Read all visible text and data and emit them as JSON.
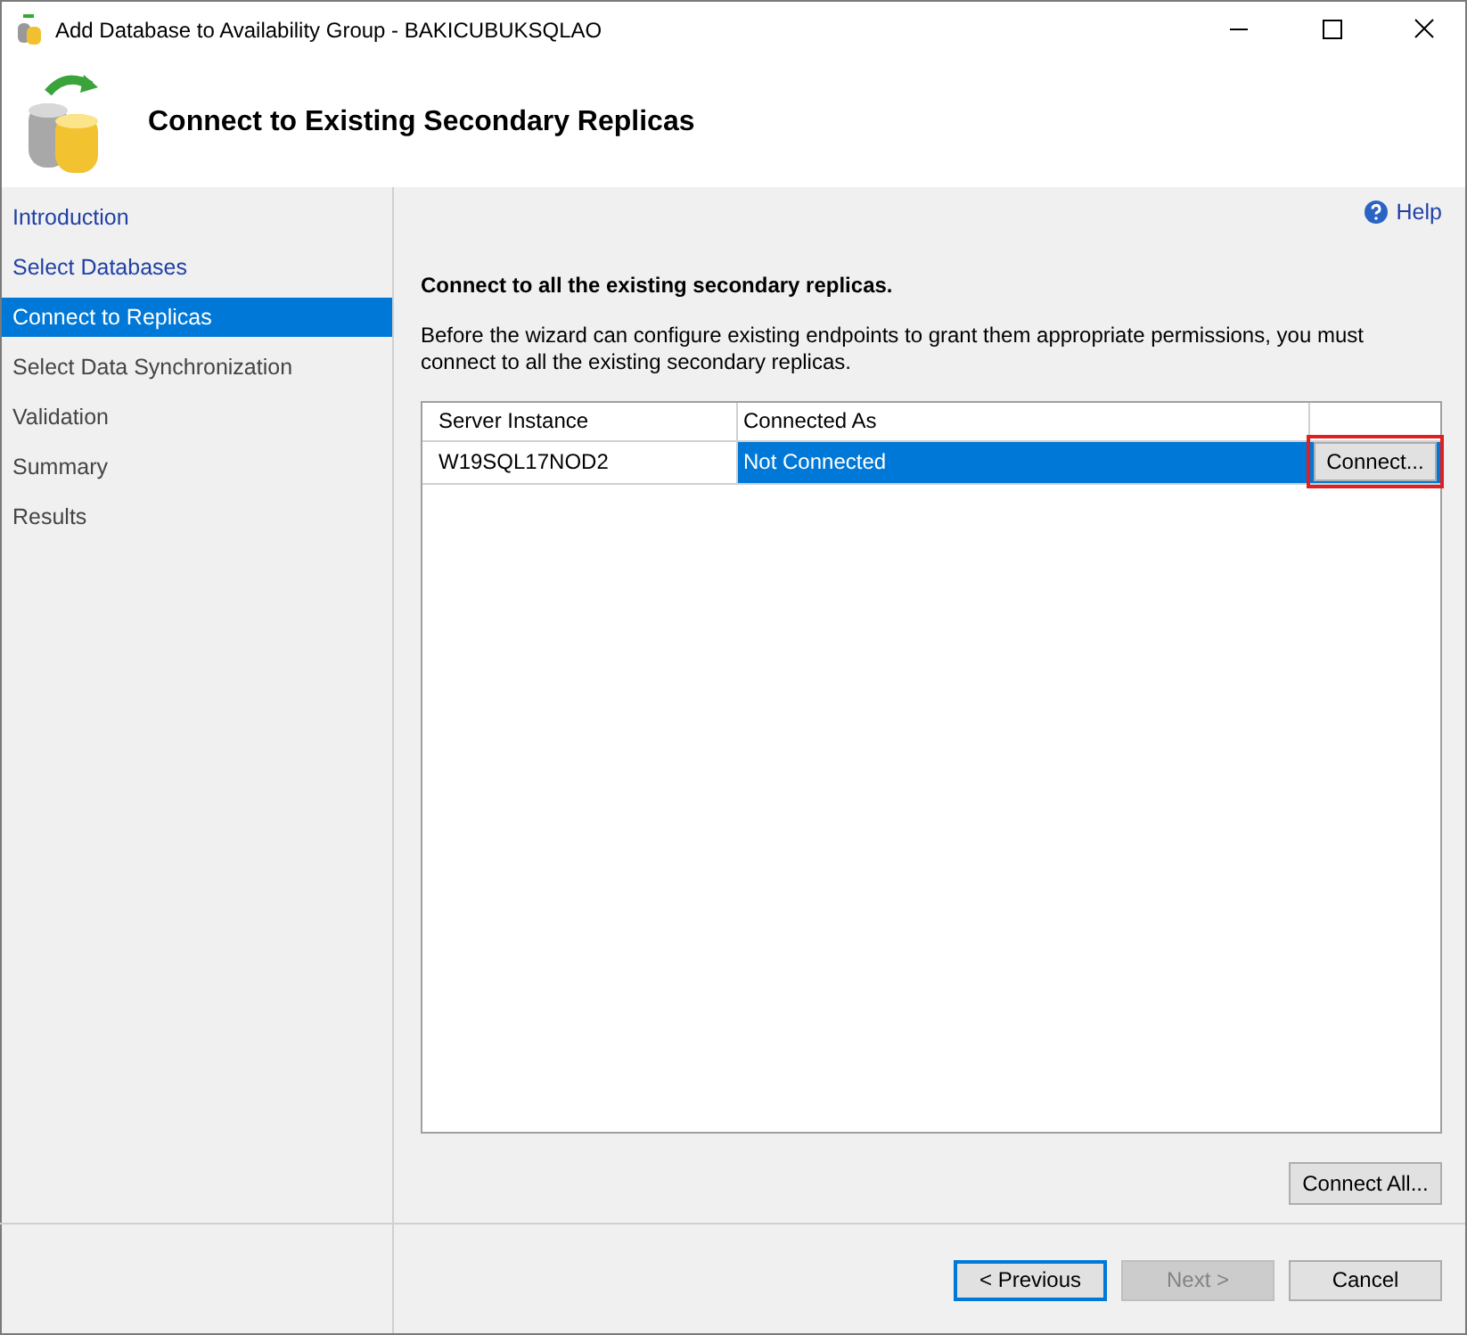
{
  "window": {
    "title": "Add Database to Availability Group - BAKICUBUKSQLAO"
  },
  "header": {
    "title": "Connect to Existing Secondary Replicas"
  },
  "sidebar": {
    "items": [
      {
        "label": "Introduction",
        "selected": false,
        "visited": true
      },
      {
        "label": "Select Databases",
        "selected": false,
        "visited": true
      },
      {
        "label": "Connect to Replicas",
        "selected": true,
        "visited": true
      },
      {
        "label": "Select Data Synchronization",
        "selected": false,
        "visited": false
      },
      {
        "label": "Validation",
        "selected": false,
        "visited": false
      },
      {
        "label": "Summary",
        "selected": false,
        "visited": false
      },
      {
        "label": "Results",
        "selected": false,
        "visited": false
      }
    ]
  },
  "help": {
    "label": "Help"
  },
  "instruction": "Connect to all the existing secondary replicas.",
  "description": "Before the wizard can configure existing endpoints to grant them appropriate permissions, you must connect to all the existing secondary replicas.",
  "table": {
    "columns": [
      "Server Instance",
      "Connected As"
    ],
    "rows": [
      {
        "server_instance": "W19SQL17NOD2",
        "connected_as": "Not Connected",
        "selected": true,
        "button": {
          "label": "Connect...",
          "highlighted": true
        }
      }
    ]
  },
  "connect_all_button": {
    "label": "Connect All..."
  },
  "buttons": [
    {
      "label": "< Previous",
      "disabled": false,
      "focused": true
    },
    {
      "label": "Next >",
      "disabled": true,
      "focused": false
    },
    {
      "label": "Cancel",
      "disabled": false,
      "focused": false
    }
  ]
}
